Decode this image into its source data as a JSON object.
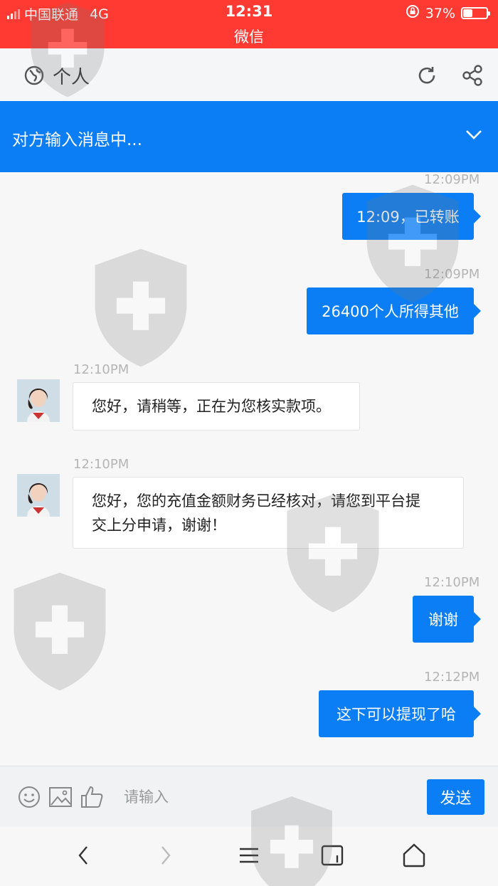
{
  "status_bar": {
    "carrier": "中国联通",
    "network": "4G",
    "time": "12:31",
    "app_name": "微信",
    "battery_percent": "37%",
    "battery_level": 0.37
  },
  "header": {
    "title": "个人",
    "icons": [
      "globe-icon",
      "refresh-icon",
      "share-icon"
    ]
  },
  "banner": {
    "text": "对方输入消息中...",
    "icon": "chevron-down-icon"
  },
  "messages": [
    {
      "direction": "out",
      "time": "12:09PM",
      "text": "12:09，已转账"
    },
    {
      "direction": "out",
      "time": "12:09PM",
      "text": "26400个人所得其他"
    },
    {
      "direction": "in",
      "time": "12:10PM",
      "text": "您好，请稍等，正在为您核实款项。"
    },
    {
      "direction": "in",
      "time": "12:10PM",
      "text_lines": [
        "您好，您的充值金额财务已经核对，请您到平台提",
        "交上分申请，谢谢！"
      ]
    },
    {
      "direction": "out",
      "time": "12:10PM",
      "text": "谢谢"
    },
    {
      "direction": "out",
      "time": "12:12PM",
      "text": "这下可以提现了哈"
    }
  ],
  "input_bar": {
    "placeholder": "请输入",
    "send_label": "发送",
    "icons": [
      "emoji-icon",
      "image-icon",
      "thumbs-up-icon"
    ]
  },
  "nav_bar": {
    "icons": [
      "back-icon",
      "forward-icon",
      "menu-icon",
      "tabs-icon",
      "home-icon"
    ]
  },
  "colors": {
    "status_bar": "#fe3a32",
    "accent": "#0b7ef5",
    "background": "#f7f7f7"
  }
}
